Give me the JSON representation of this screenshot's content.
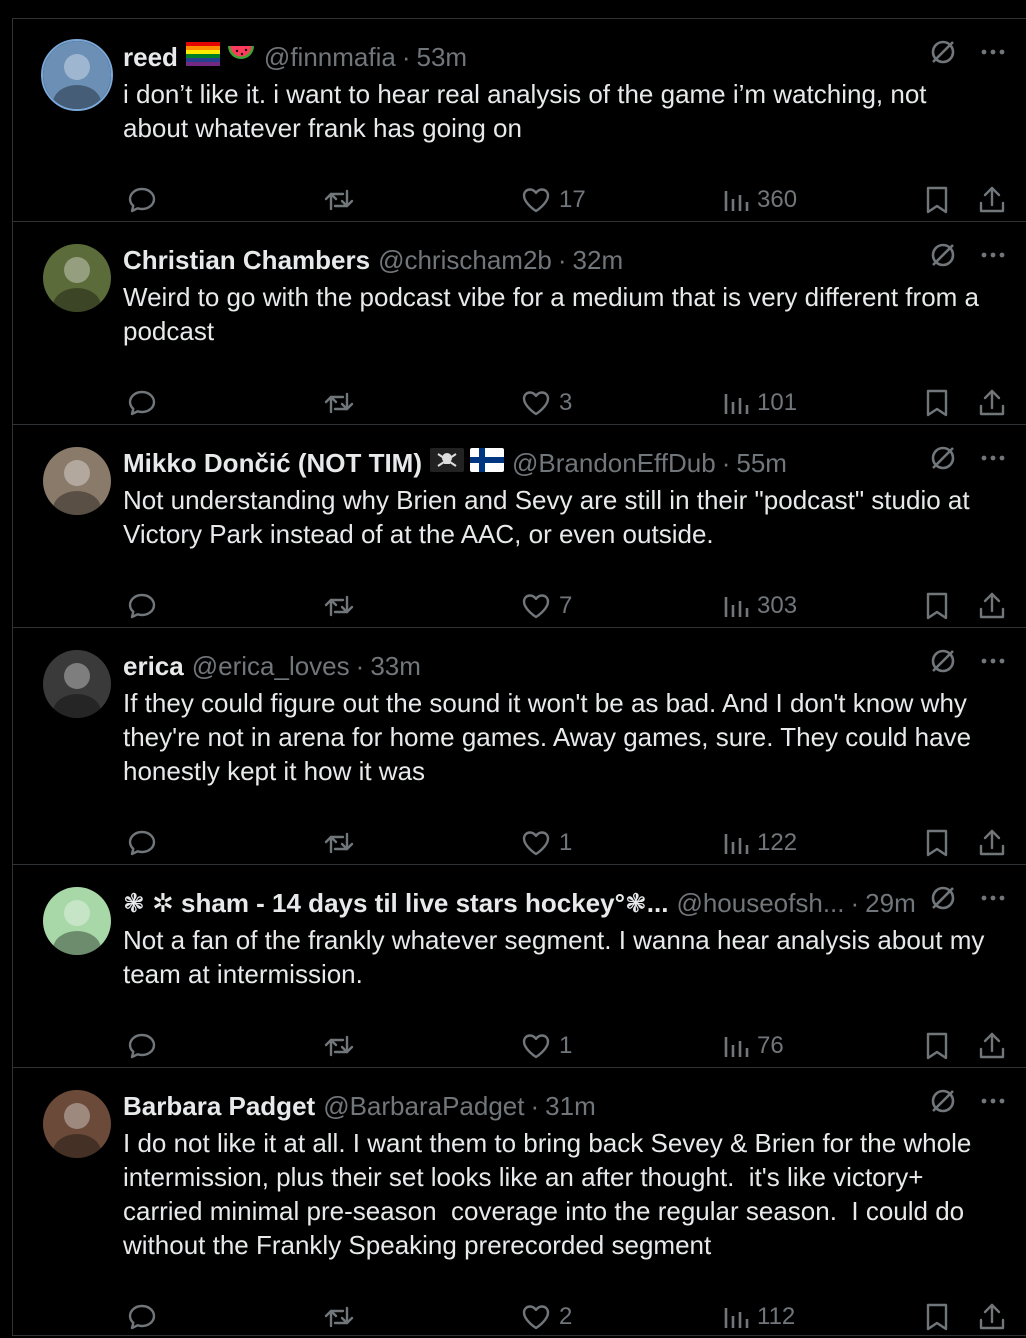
{
  "colors": {
    "background": "#000000",
    "text": "#e7e9ea",
    "muted": "#71767b",
    "divider": "#2f3336"
  },
  "tweets": [
    {
      "name": "reed",
      "badges": [
        "rainbow-flag-icon",
        "watermelon-icon"
      ],
      "handle": "@finnmafia",
      "time": "53m",
      "text": "i don’t like it. i want to hear real analysis of the game i’m watching, not\nabout whatever frank has going on",
      "likes": "17",
      "views": "360",
      "avatar_color": "#6b8fb5"
    },
    {
      "name": "Christian Chambers",
      "badges": [],
      "handle": "@chrischam2b",
      "time": "32m",
      "text": "Weird to go with the podcast vibe for a medium that is very different from a\npodcast",
      "likes": "3",
      "views": "101",
      "avatar_color": "#5c6b3a"
    },
    {
      "name": "Mikko Dončić (NOT TIM)",
      "badges": [
        "pirate-flag-icon",
        "finland-flag-icon"
      ],
      "handle": "@BrandonEffDub",
      "time": "55m",
      "text": "Not understanding why Brien and Sevy are still in their \"podcast\" studio at\nVictory Park instead of at the AAC, or even outside.",
      "likes": "7",
      "views": "303",
      "avatar_color": "#8a7a6a"
    },
    {
      "name": "erica",
      "badges": [],
      "handle": "@erica_loves",
      "time": "33m",
      "text": "If they could figure out the sound it won't be as bad. And I don't know why\nthey're not in arena for home games. Away games, sure. They could have\nhonestly kept it how it was",
      "likes": "1",
      "views": "122",
      "avatar_color": "#3a3a3a"
    },
    {
      "name": "❃ ✲ sham - 14 days til live stars hockey°❃...",
      "badges": [],
      "handle": "@houseofsh...",
      "time": "29m",
      "text": "Not a fan of the frankly whatever segment. I wanna hear analysis about my\nteam at intermission.",
      "likes": "1",
      "views": "76",
      "avatar_color": "#a8d8a8"
    },
    {
      "name": "Barbara Padget",
      "badges": [],
      "handle": "@BarbaraPadget",
      "time": "31m",
      "text": "I do not like it at all. I want them to bring back Sevey & Brien for the whole\nintermission, plus their set looks like an after thought.  it's like victory+\ncarried minimal pre-season  coverage into the regular season.  I could do\nwithout the Frankly Speaking prerecorded segment",
      "likes": "2",
      "views": "112",
      "avatar_color": "#6b4a3a"
    }
  ]
}
